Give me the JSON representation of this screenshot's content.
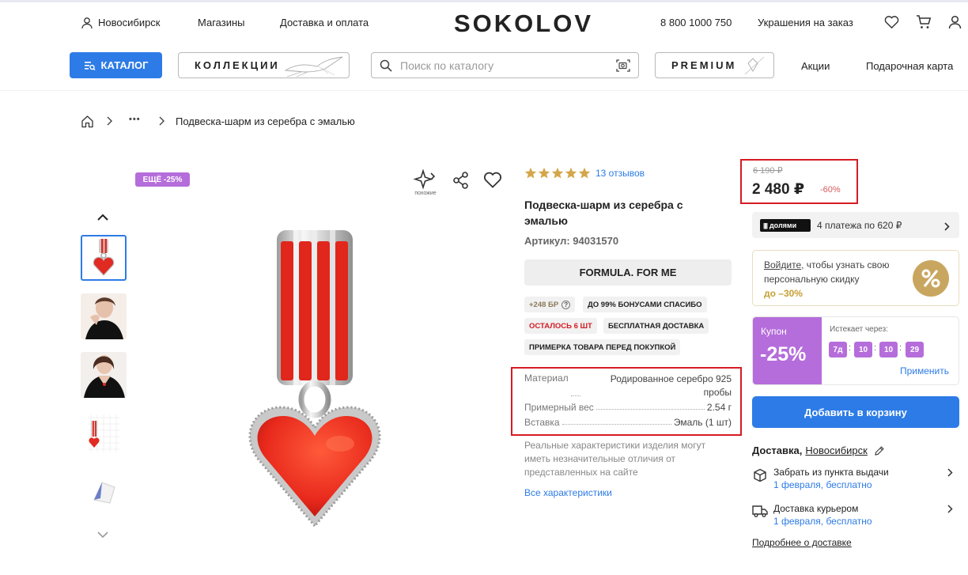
{
  "header": {
    "city": "Новосибирск",
    "stores": "Магазины",
    "delivery": "Доставка и оплата",
    "logo": "SOKOLOV",
    "phone": "8 800 1000 750",
    "custom": "Украшения на заказ",
    "catalog_btn": "КАТАЛОГ",
    "collections_btn": "КОЛЛЕКЦИИ",
    "search_placeholder": "Поиск по каталогу",
    "premium_btn": "PREMIUM",
    "promo": "Акции",
    "gift_card": "Подарочная карта"
  },
  "breadcrumb": {
    "more": "•••",
    "current": "Подвеска-шарм из серебра с эмалью"
  },
  "gallery": {
    "badge": "ЕЩЁ -25%",
    "similar_label": "похожие"
  },
  "product": {
    "reviews": "13 отзывов",
    "rating": 5,
    "title_line1": "Подвеска-шарм из серебра с",
    "title_line2": "эмалью",
    "article": "Артикул: 94031570",
    "collection_btn": "FORMULA. FOR ME",
    "chips": {
      "bonus": "+248 БР",
      "bonus_help": "?",
      "spasibo": "ДО 99% БОНУСАМИ СПАСИБО",
      "remaining": "ОСТАЛОСЬ 6 ШТ",
      "free_delivery": "БЕСПЛАТНАЯ ДОСТАВКА",
      "fitting": "ПРИМЕРКА ТОВАРА ПЕРЕД ПОКУПКОЙ"
    },
    "specs": {
      "material_label": "Материал",
      "material_line1": "Родированное серебро 925",
      "material_line2": "пробы",
      "weight_label": "Примерный вес",
      "weight_value": "2.54 г",
      "insert_label": "Вставка",
      "insert_value": "Эмаль (1 шт)"
    },
    "disclaimer_1": "Реальные характеристики изделия могут",
    "disclaimer_2": "иметь незначительные отличия от",
    "disclaimer_3": "представленных на сайте",
    "all_specs": "Все характеристики"
  },
  "purchase": {
    "old_price": "6 190 ₽",
    "price": "2 480 ₽",
    "discount": "-60%",
    "dolyami_logo": "долями",
    "installments": "4 платежа по 620 ₽",
    "login_link": "Войдите",
    "login_text_1": ", чтобы узнать свою",
    "login_text_2": "персональную скидку",
    "login_text_3": "до –30%",
    "coupon_label": "Купон",
    "coupon_value": "-25%",
    "expires_label": "Истекает через:",
    "timer": {
      "days": "7д",
      "hours": "10",
      "minutes": "10",
      "seconds": "29"
    },
    "apply": "Применить",
    "add_to_cart": "Добавить в корзину",
    "delivery_label": "Доставка,",
    "delivery_city": "Новосибирск",
    "pickup_title": "Забрать из пункта выдачи",
    "pickup_date": "1 февраля, бесплатно",
    "courier_title": "Доставка курьером",
    "courier_date": "1 февраля, бесплатно",
    "delivery_more": "Подробнее о доставке"
  },
  "colors": {
    "accent_blue": "#2d7be6",
    "purple": "#b56ddb",
    "gold": "#d4b06a",
    "annotation_red": "#d61b23"
  }
}
